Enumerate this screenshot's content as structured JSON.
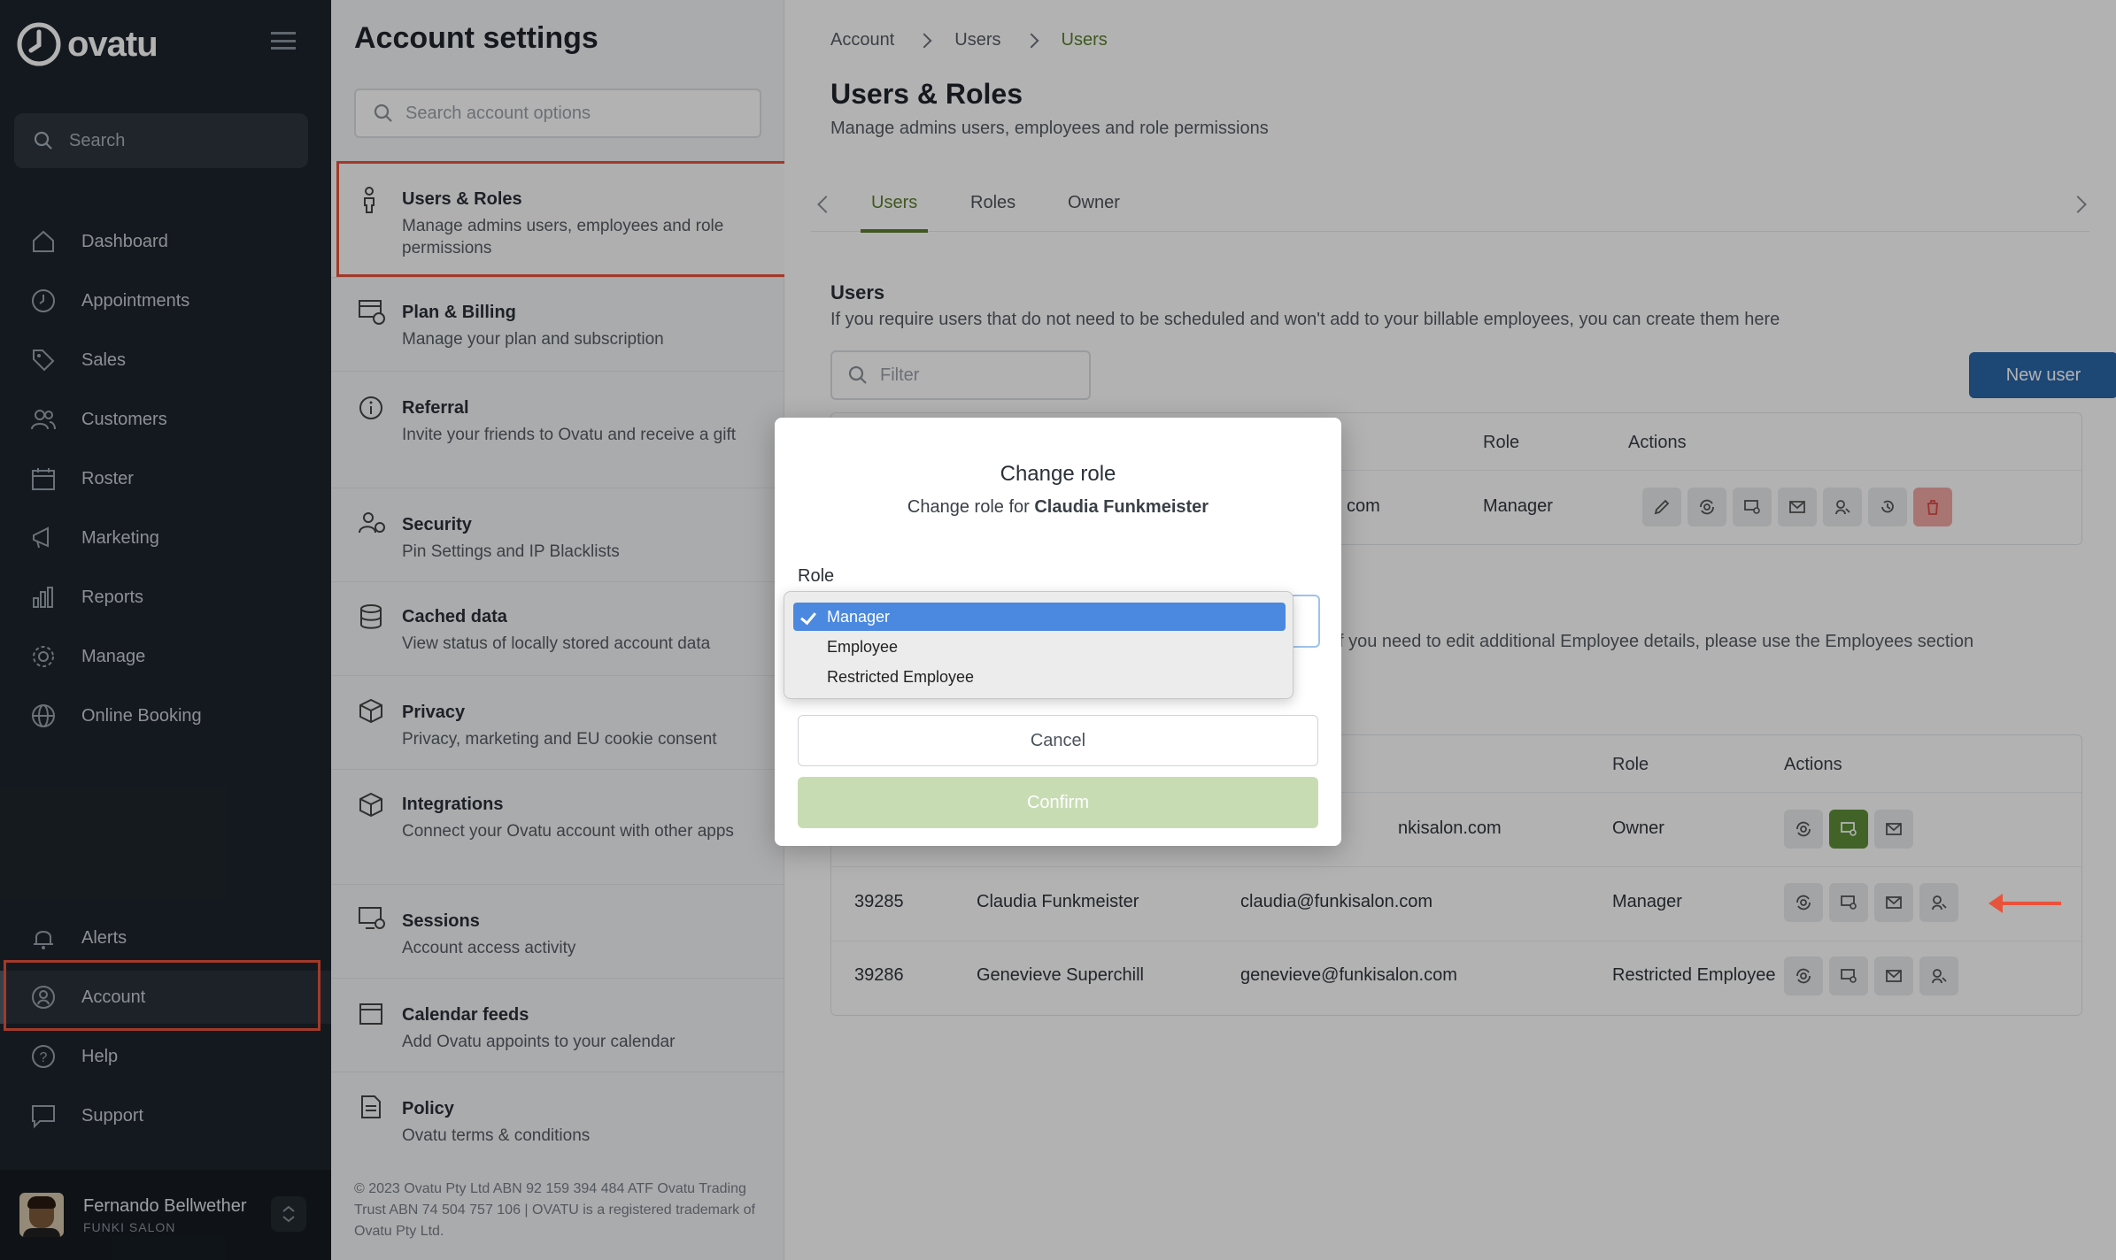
{
  "sidebar": {
    "brand": "ovatu",
    "search_label": "Search",
    "items": [
      {
        "label": "Dashboard"
      },
      {
        "label": "Appointments"
      },
      {
        "label": "Sales"
      },
      {
        "label": "Customers"
      },
      {
        "label": "Roster"
      },
      {
        "label": "Marketing"
      },
      {
        "label": "Reports"
      },
      {
        "label": "Manage"
      },
      {
        "label": "Online Booking"
      }
    ],
    "bottom_items": [
      {
        "label": "Alerts"
      },
      {
        "label": "Account"
      },
      {
        "label": "Help"
      },
      {
        "label": "Support"
      }
    ],
    "user": {
      "name": "Fernando Bellwether",
      "salon": "FUNKI SALON"
    }
  },
  "settings": {
    "title": "Account settings",
    "search_placeholder": "Search account options",
    "items": [
      {
        "title": "Users & Roles",
        "desc": "Manage admins users, employees and role permissions"
      },
      {
        "title": "Plan & Billing",
        "desc": "Manage your plan and subscription"
      },
      {
        "title": "Referral",
        "desc": "Invite your friends to Ovatu and receive a gift"
      },
      {
        "title": "Security",
        "desc": "Pin Settings and IP Blacklists"
      },
      {
        "title": "Cached data",
        "desc": "View status of locally stored account data"
      },
      {
        "title": "Privacy",
        "desc": "Privacy, marketing and EU cookie consent"
      },
      {
        "title": "Integrations",
        "desc": "Connect your Ovatu account with other apps"
      },
      {
        "title": "Sessions",
        "desc": "Account access activity"
      },
      {
        "title": "Calendar feeds",
        "desc": "Add Ovatu appoints to your calendar"
      },
      {
        "title": "Policy",
        "desc": "Ovatu terms & conditions"
      }
    ],
    "footer": "© 2023 Ovatu Pty Ltd ABN 92 159 394 484 ATF Ovatu Trading Trust ABN 74 504 757 106 | OVATU is a registered trademark of Ovatu Pty Ltd."
  },
  "main": {
    "breadcrumb": [
      "Account",
      "Users",
      "Users"
    ],
    "title": "Users & Roles",
    "subtitle": "Manage admins users, employees and role permissions",
    "tabs": [
      "Users",
      "Roles",
      "Owner"
    ],
    "users_section": {
      "heading": "Users",
      "desc": "If you require users that do not need to be scheduled and won't add to your billable employees, you can create them here",
      "filter_placeholder": "Filter",
      "new_user_label": "New user",
      "headers": {
        "role": "Role",
        "actions": "Actions"
      },
      "rows": [
        {
          "email_fragment": "com",
          "role": "Manager"
        }
      ]
    },
    "employees_section": {
      "desc_fragment": "f you need to edit additional Employee details, please use the Employees section",
      "headers": {
        "role": "Role",
        "actions": "Actions"
      },
      "rows": [
        {
          "id": "",
          "name": "",
          "email": "nkisalon.com",
          "role": "Owner"
        },
        {
          "id": "39285",
          "name": "Claudia Funkmeister",
          "email": "claudia@funkisalon.com",
          "role": "Manager"
        },
        {
          "id": "39286",
          "name": "Genevieve Superchill",
          "email": "genevieve@funkisalon.com",
          "role": "Restricted Employee"
        }
      ]
    }
  },
  "modal": {
    "title": "Change role",
    "subtitle_prefix": "Change role for",
    "subtitle_name": "Claudia Funkmeister",
    "role_label": "Role",
    "options": [
      "Manager",
      "Employee",
      "Restricted Employee"
    ],
    "selected": "Manager",
    "cancel_label": "Cancel",
    "confirm_label": "Confirm"
  },
  "colors": {
    "accent_green": "#5b7f2e",
    "highlight_red": "#e8533c",
    "primary_blue": "#2a66a8"
  }
}
